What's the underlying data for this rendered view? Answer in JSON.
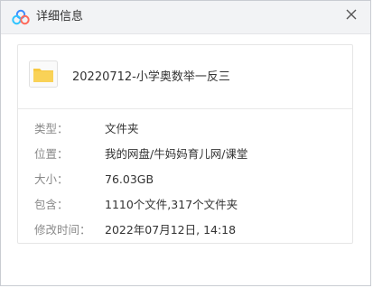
{
  "window": {
    "title": "详细信息"
  },
  "file": {
    "name": "20220712-小学奥数举一反三"
  },
  "details": [
    {
      "label": "类型：",
      "value": "文件夹"
    },
    {
      "label": "位置：",
      "value": "我的网盘/牛妈妈育儿网/课堂"
    },
    {
      "label": "大小：",
      "value": "76.03GB"
    },
    {
      "label": "包含：",
      "value": "1110个文件,317个文件夹"
    },
    {
      "label": "修改时间：",
      "value": "2022年07月12日, 14:18"
    }
  ],
  "colors": {
    "titlebar": "#f2f3f5",
    "folder": "#f7c942",
    "label": "#8a8a8a"
  },
  "icons": {
    "app": "cloud-logo-icon",
    "close": "close-icon",
    "file": "folder-icon"
  }
}
